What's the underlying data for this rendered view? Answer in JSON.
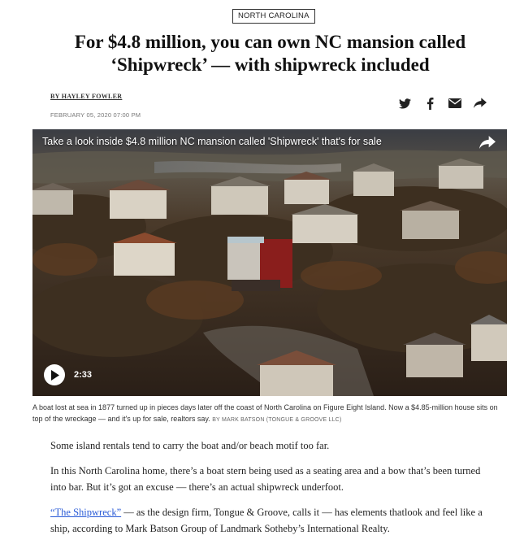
{
  "section_tag": "NORTH CAROLINA",
  "headline": "For $4.8 million, you can own NC mansion called ‘Shipwreck’ — with shipwreck included",
  "byline": "BY HAYLEY FOWLER",
  "date": "FEBRUARY 05, 2020 07:00 PM",
  "share_icons": [
    "twitter-icon",
    "facebook-icon",
    "email-icon",
    "share-icon"
  ],
  "video": {
    "title": "Take a look inside $4.8 million NC mansion called 'Shipwreck' that's for sale",
    "duration": "2:33"
  },
  "caption": {
    "text": "A boat lost at sea in 1877 turned up in pieces days later off the coast of North Carolina on Figure Eight Island. Now a $4.85-million house sits on top of the wreckage — and it's up for sale, realtors say.",
    "credit": "BY MARK BATSON (TONGUE & GROOVE LLC)"
  },
  "body": {
    "p1": "Some island rentals tend to carry the boat and/or beach motif too far.",
    "p2": "In this North Carolina home, there’s a boat stern being used as a seating area and a bow that’s been turned into bar. But it’s got an excuse — there’s an actual shipwreck underfoot.",
    "p3_link": "“The Shipwreck”",
    "p3_rest": " — as the design firm, Tongue & Groove, calls it — has elements thatlook and feel like a ship, according to Mark Batson Group of Landmark Sotheby’s International Realty."
  }
}
